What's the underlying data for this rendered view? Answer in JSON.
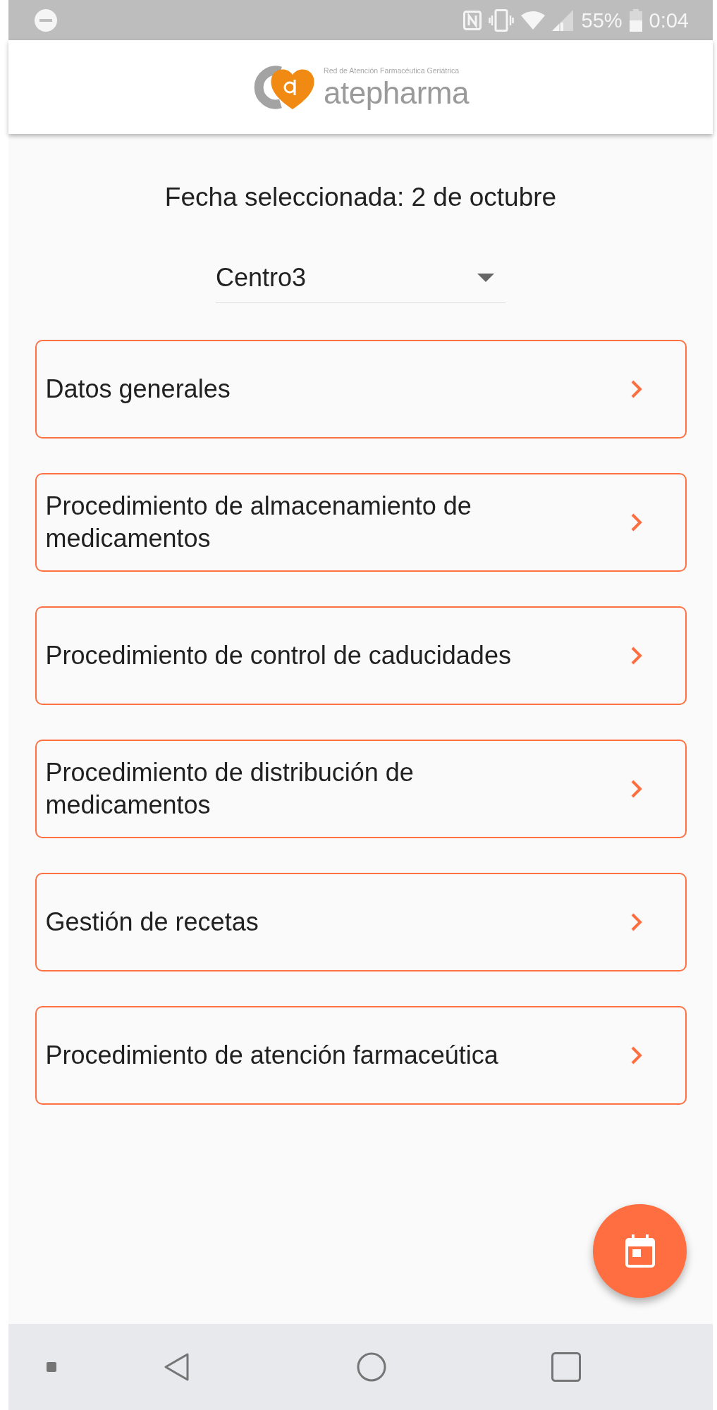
{
  "status_bar": {
    "battery_text": "55%",
    "time": "0:04"
  },
  "header": {
    "logo_tagline": "Red de Atención Farmacéutica Geriátrica",
    "logo_name": "atepharma"
  },
  "date_label": "Fecha seleccionada: 2 de octubre",
  "center_select": {
    "value": "Centro3"
  },
  "sections": [
    {
      "label": "Datos generales"
    },
    {
      "label": "Procedimiento de almacenamiento de medicamentos"
    },
    {
      "label": "Procedimiento de control de caducidades"
    },
    {
      "label": "Procedimiento de distribución de medicamentos"
    },
    {
      "label": "Gestión de recetas"
    },
    {
      "label": "Procedimiento de atención farmaceútica"
    }
  ]
}
